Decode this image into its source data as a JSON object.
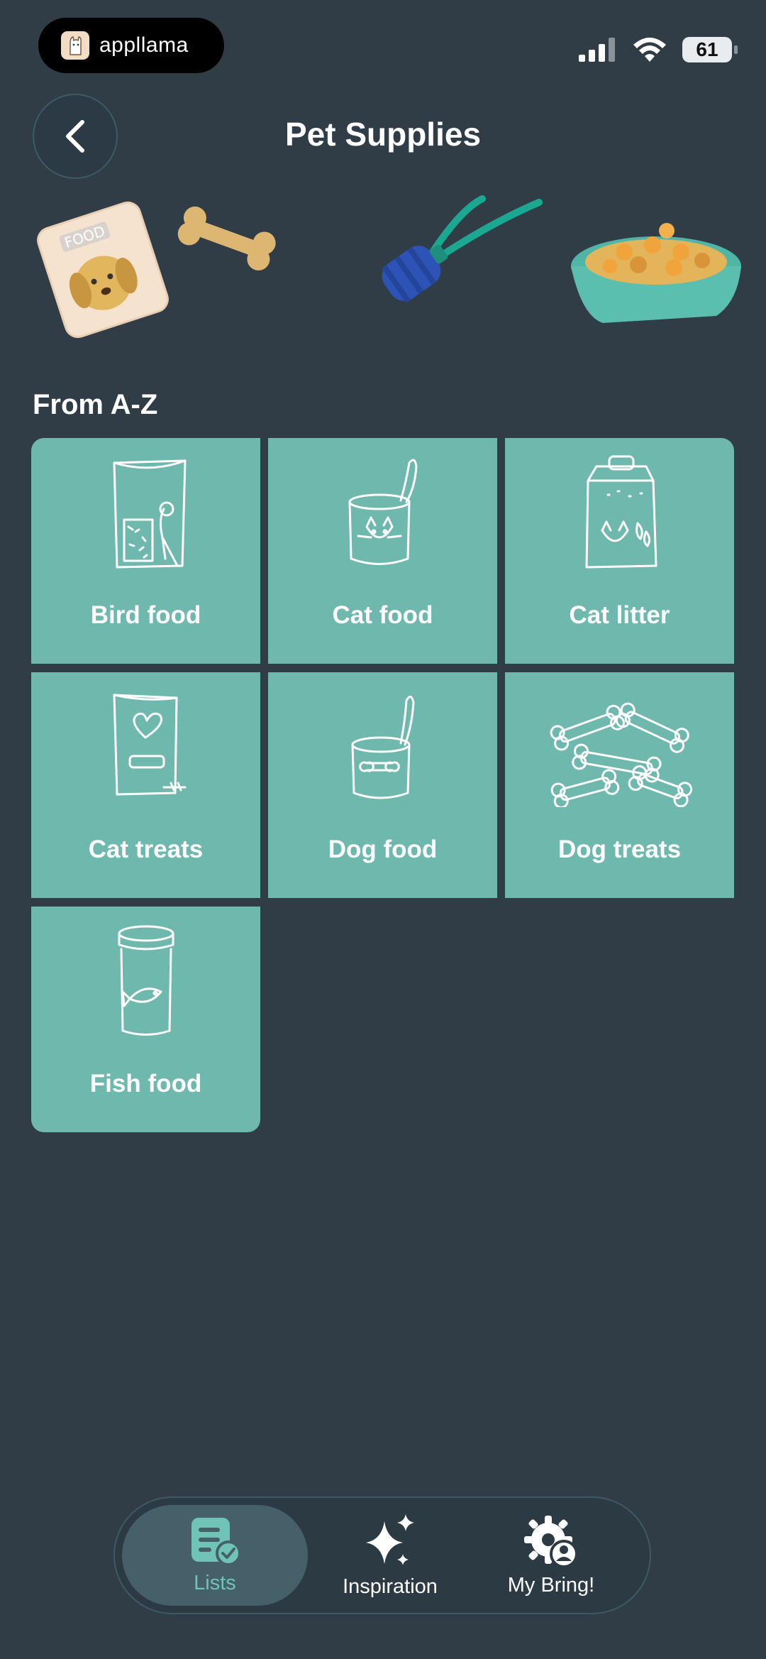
{
  "status_bar": {
    "brand": "appllama",
    "battery": "61"
  },
  "header": {
    "title": "Pet Supplies",
    "back_icon": "chevron-left-icon"
  },
  "hero": {
    "items": [
      "dog-food-bag",
      "bone",
      "rope-toy",
      "food-bowl"
    ],
    "bag_text": "FOOD"
  },
  "section": {
    "title": "From A-Z"
  },
  "categories": [
    {
      "label": "Bird food",
      "icon": "bird-food-icon"
    },
    {
      "label": "Cat food",
      "icon": "cat-food-can-icon"
    },
    {
      "label": "Cat litter",
      "icon": "cat-litter-bag-icon"
    },
    {
      "label": "Cat treats",
      "icon": "cat-treats-bag-icon"
    },
    {
      "label": "Dog food",
      "icon": "dog-food-can-icon"
    },
    {
      "label": "Dog treats",
      "icon": "dog-treats-bones-icon"
    },
    {
      "label": "Fish food",
      "icon": "fish-food-jar-icon"
    }
  ],
  "nav": {
    "items": [
      {
        "label": "Lists",
        "icon": "list-check-icon",
        "active": true
      },
      {
        "label": "Inspiration",
        "icon": "sparkles-icon",
        "active": false
      },
      {
        "label": "My Bring!",
        "icon": "gear-user-icon",
        "active": false
      }
    ]
  },
  "colors": {
    "background": "#303d47",
    "tile": "#6fb8ad",
    "accent": "#6fc3b7",
    "nav_active": "#46606a"
  }
}
